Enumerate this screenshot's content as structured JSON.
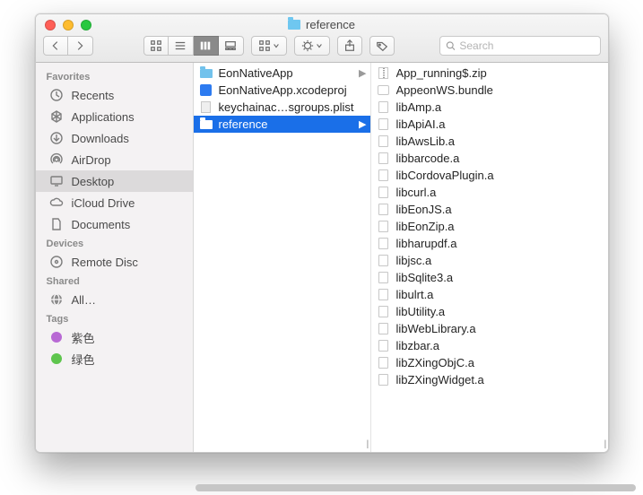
{
  "window": {
    "title": "reference"
  },
  "search": {
    "placeholder": "Search"
  },
  "sidebar": {
    "sections": [
      {
        "header": "Favorites",
        "items": [
          {
            "label": "Recents",
            "icon": "recents"
          },
          {
            "label": "Applications",
            "icon": "apps"
          },
          {
            "label": "Downloads",
            "icon": "downloads"
          },
          {
            "label": "AirDrop",
            "icon": "airdrop"
          },
          {
            "label": "Desktop",
            "icon": "desktop",
            "selected": true
          },
          {
            "label": "iCloud Drive",
            "icon": "icloud"
          },
          {
            "label": "Documents",
            "icon": "documents"
          }
        ]
      },
      {
        "header": "Devices",
        "items": [
          {
            "label": "Remote Disc",
            "icon": "disc"
          }
        ]
      },
      {
        "header": "Shared",
        "items": [
          {
            "label": "All…",
            "icon": "network"
          }
        ]
      },
      {
        "header": "Tags",
        "items": [
          {
            "label": "紫色",
            "tagcolor": "#b869d4"
          },
          {
            "label": "绿色",
            "tagcolor": "#5ec54d"
          }
        ]
      }
    ]
  },
  "columns": [
    {
      "items": [
        {
          "label": "EonNativeApp",
          "type": "folder",
          "hasChildren": true
        },
        {
          "label": "EonNativeApp.xcodeproj",
          "type": "xcode"
        },
        {
          "label": "keychainac…sgroups.plist",
          "type": "plist"
        },
        {
          "label": "reference",
          "type": "folder",
          "hasChildren": true,
          "selected": true
        }
      ]
    },
    {
      "items": [
        {
          "label": "App_running$.zip",
          "type": "zip"
        },
        {
          "label": "AppeonWS.bundle",
          "type": "bundle"
        },
        {
          "label": "libAmp.a",
          "type": "file"
        },
        {
          "label": "libApiAI.a",
          "type": "file"
        },
        {
          "label": "libAwsLib.a",
          "type": "file"
        },
        {
          "label": "libbarcode.a",
          "type": "file"
        },
        {
          "label": "libCordovaPlugin.a",
          "type": "file"
        },
        {
          "label": "libcurl.a",
          "type": "file"
        },
        {
          "label": "libEonJS.a",
          "type": "file"
        },
        {
          "label": "libEonZip.a",
          "type": "file"
        },
        {
          "label": "libharupdf.a",
          "type": "file"
        },
        {
          "label": "libjsc.a",
          "type": "file"
        },
        {
          "label": "libSqlite3.a",
          "type": "file"
        },
        {
          "label": "libulrt.a",
          "type": "file"
        },
        {
          "label": "libUtility.a",
          "type": "file"
        },
        {
          "label": "libWebLibrary.a",
          "type": "file"
        },
        {
          "label": "libzbar.a",
          "type": "file"
        },
        {
          "label": "libZXingObjC.a",
          "type": "file"
        },
        {
          "label": "libZXingWidget.a",
          "type": "file"
        }
      ]
    }
  ]
}
